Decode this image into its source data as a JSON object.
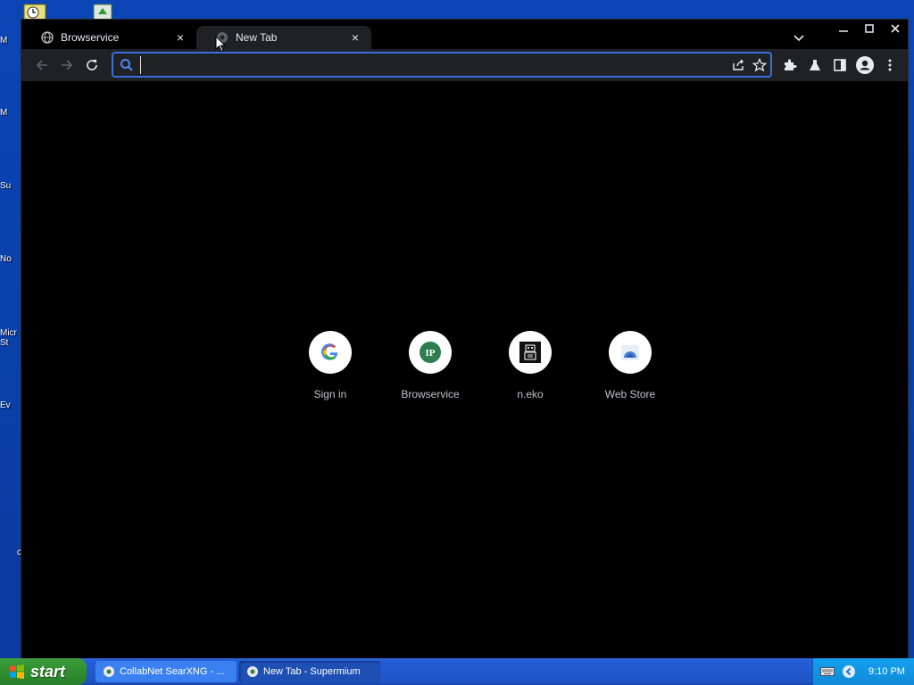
{
  "desktop": {
    "icon_labels": [
      "M",
      "M",
      "Su",
      "No",
      "Micr St",
      "Ev",
      "c"
    ]
  },
  "browser": {
    "tabs": [
      {
        "title": "Browservice",
        "close": "×"
      },
      {
        "title": "New Tab",
        "close": "×"
      }
    ],
    "omnibox": {
      "value": "",
      "placeholder": ""
    },
    "shortcuts": [
      {
        "label": "Sign in",
        "icon": "google-icon"
      },
      {
        "label": "Browservice",
        "icon": "ip-icon",
        "badge": "IP"
      },
      {
        "label": "n.eko",
        "icon": "neko-icon"
      },
      {
        "label": "Web Store",
        "icon": "web-store-icon"
      }
    ]
  },
  "taskbar": {
    "start_label": "start",
    "tasks": [
      {
        "label": "CollabNet SearXNG - ..."
      },
      {
        "label": "New Tab - Supermium"
      }
    ],
    "clock": "9:10 PM"
  },
  "colors": {
    "accent": "#3b6fd8",
    "toolbar": "#202124",
    "desktop": "#0a3fa8"
  }
}
